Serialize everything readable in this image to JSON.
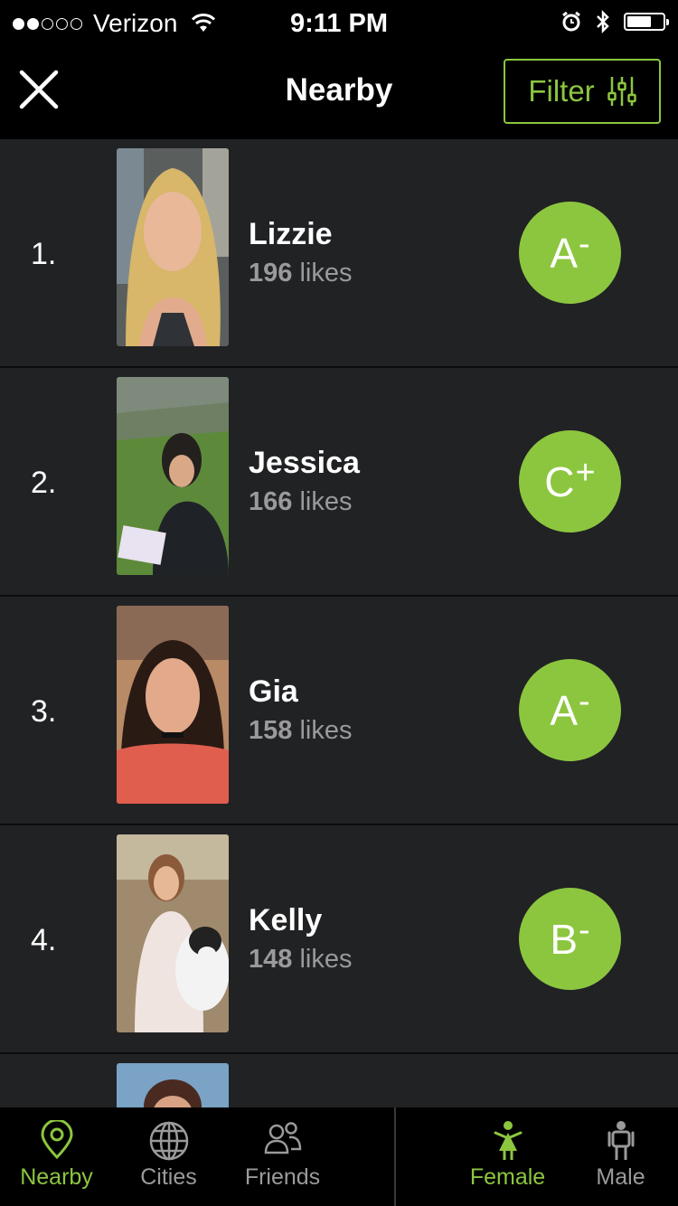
{
  "status_bar": {
    "carrier": "Verizon",
    "time": "9:11 PM",
    "signal_bars_filled": 2,
    "signal_bars_total": 5
  },
  "nav": {
    "title": "Nearby",
    "filter_label": "Filter",
    "close_icon": "close-icon",
    "filter_icon": "sliders-icon"
  },
  "list": [
    {
      "rank": "1.",
      "name": "Lizzie",
      "likes_count": "196",
      "likes_word": "likes",
      "grade_letter": "A",
      "grade_mod": "-"
    },
    {
      "rank": "2.",
      "name": "Jessica",
      "likes_count": "166",
      "likes_word": "likes",
      "grade_letter": "C",
      "grade_mod": "+"
    },
    {
      "rank": "3.",
      "name": "Gia",
      "likes_count": "158",
      "likes_word": "likes",
      "grade_letter": "A",
      "grade_mod": "-"
    },
    {
      "rank": "4.",
      "name": "Kelly",
      "likes_count": "148",
      "likes_word": "likes",
      "grade_letter": "B",
      "grade_mod": "-"
    }
  ],
  "tabs": {
    "nearby": "Nearby",
    "cities": "Cities",
    "friends": "Friends",
    "female": "Female",
    "male": "Male"
  },
  "colors": {
    "accent": "#8cc63f",
    "background": "#212224",
    "bar": "#000000",
    "muted_text": "#9a9a9c"
  }
}
